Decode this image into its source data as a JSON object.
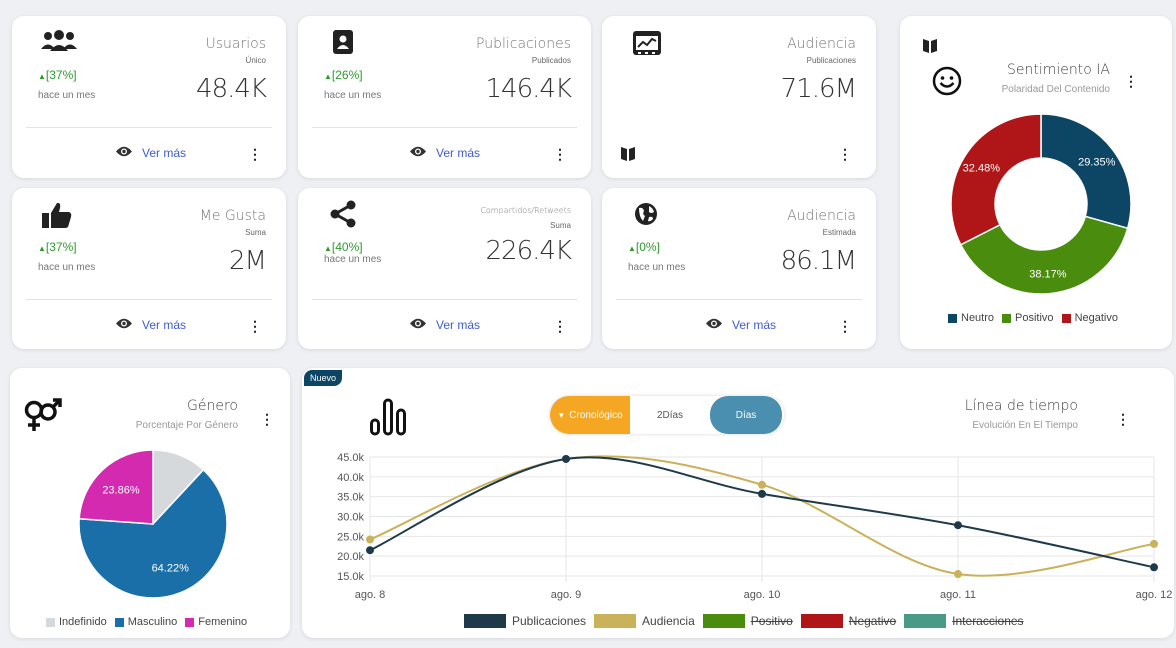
{
  "stats": [
    {
      "title": "Usuarios",
      "sub": "Único",
      "value": "48.4K",
      "delta": "[37%]",
      "ago": "hace un mes",
      "link": "Ver más"
    },
    {
      "title": "Publicaciones",
      "sub": "Publicados",
      "value": "146.4K",
      "delta": "[26%]",
      "ago": "hace un mes",
      "link": "Ver más"
    },
    {
      "title": "Audiencia",
      "sub": "Publicaciones",
      "value": "71.6M"
    },
    {
      "title": "Me Gusta",
      "sub": "Suma",
      "value": "2M",
      "delta": "[37%]",
      "ago": "hace un mes",
      "link": "Ver más"
    },
    {
      "title": "Compartidos/Retweets",
      "sub": "Suma",
      "value": "226.4K",
      "delta": "[40%]",
      "ago": "hace un mes",
      "link": "Ver más"
    },
    {
      "title": "Audiencia",
      "sub": "Estimada",
      "value": "86.1M",
      "delta": "[0%]",
      "ago": "hace un mes",
      "link": "Ver más"
    }
  ],
  "sentiment": {
    "title": "Sentimiento IA",
    "subtitle": "Polaridad Del Contenido",
    "legend": [
      "Neutro",
      "Positivo",
      "Negativo"
    ]
  },
  "gender": {
    "title": "Género",
    "subtitle": "Porcentaje Por Género",
    "legend": [
      "Indefinido",
      "Masculino",
      "Femenino"
    ]
  },
  "timeline": {
    "badge": "Nuevo",
    "title": "Línea de tiempo",
    "subtitle": "Evolución En El Tiempo",
    "toggles": [
      "Cronológico",
      "2Días",
      "Días"
    ],
    "legend": [
      "Publicaciones",
      "Audiencia",
      "Positivo",
      "Negativo",
      "Interacciones"
    ]
  },
  "colors": {
    "neutro": "#0d4565",
    "positivo": "#4a8c0d",
    "negativo": "#b01617",
    "indefinido": "#d5d9db",
    "masculino": "#1b6fa8",
    "femenino": "#d42ab0",
    "publicaciones": "#1e3a4a",
    "audiencia": "#c9b25a",
    "interacciones": "#4a9a88",
    "accent_orange": "#f5a623",
    "accent_blue": "#4a8fb0",
    "delta_green": "#2e9a2e"
  },
  "chart_data": [
    {
      "type": "pie",
      "title": "Sentimiento IA",
      "donut": true,
      "categories": [
        "Neutro",
        "Positivo",
        "Negativo"
      ],
      "values": [
        29.35,
        38.17,
        32.48
      ],
      "labels": [
        "29.35%",
        "38.17%",
        "32.48%"
      ],
      "legend": "bottom"
    },
    {
      "type": "pie",
      "title": "Género",
      "categories": [
        "Indefinido",
        "Masculino",
        "Femenino"
      ],
      "values": [
        11.92,
        64.22,
        23.86
      ],
      "labels": [
        "",
        "64.22%",
        "23.86%"
      ],
      "legend": "bottom"
    },
    {
      "type": "line",
      "title": "Línea de tiempo",
      "categories": [
        "ago. 8",
        "ago. 9",
        "ago. 10",
        "ago. 11",
        "ago. 12"
      ],
      "yticks": [
        "45.0k",
        "40.0k",
        "35.0k",
        "30.0k",
        "25.0k",
        "20.0k",
        "15.0k"
      ],
      "ylim": [
        15000,
        45000
      ],
      "grid": true,
      "legend": "bottom",
      "series": [
        {
          "name": "Publicaciones",
          "values": [
            21500,
            44500,
            35700,
            27800,
            17200
          ]
        },
        {
          "name": "Audiencia",
          "values": [
            24200,
            44500,
            38000,
            15500,
            23100
          ]
        }
      ]
    }
  ]
}
